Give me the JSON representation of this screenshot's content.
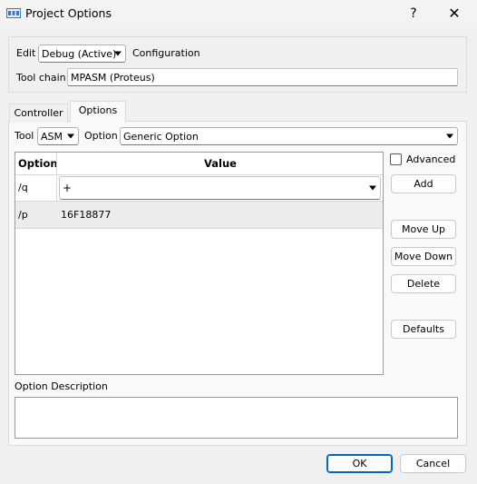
{
  "window": {
    "title": "Project Options",
    "help": "?",
    "close": "✕"
  },
  "config": {
    "edit_label": "Edit",
    "edit_value": "Debug (Active)",
    "configuration_label": "Configuration",
    "toolchain_label": "Tool chain:",
    "toolchain_value": "MPASM (Proteus)"
  },
  "tabs": [
    {
      "label": "Controller"
    },
    {
      "label": "Options"
    }
  ],
  "tool_row": {
    "tool_label": "Tool",
    "tool_value": "ASM",
    "option_label": "Option",
    "option_value": "Generic Option"
  },
  "grid": {
    "headers": [
      "Option",
      "Value"
    ],
    "rows": [
      {
        "option": "/q",
        "value": "+"
      },
      {
        "option": "/p",
        "value": "16F18877"
      }
    ]
  },
  "side": {
    "advanced_label": "Advanced",
    "advanced_checked": false,
    "add": "Add",
    "move_up": "Move Up",
    "move_down": "Move Down",
    "delete": "Delete",
    "defaults": "Defaults"
  },
  "description": {
    "label": "Option Description",
    "text": ""
  },
  "footer": {
    "ok": "OK",
    "cancel": "Cancel"
  }
}
